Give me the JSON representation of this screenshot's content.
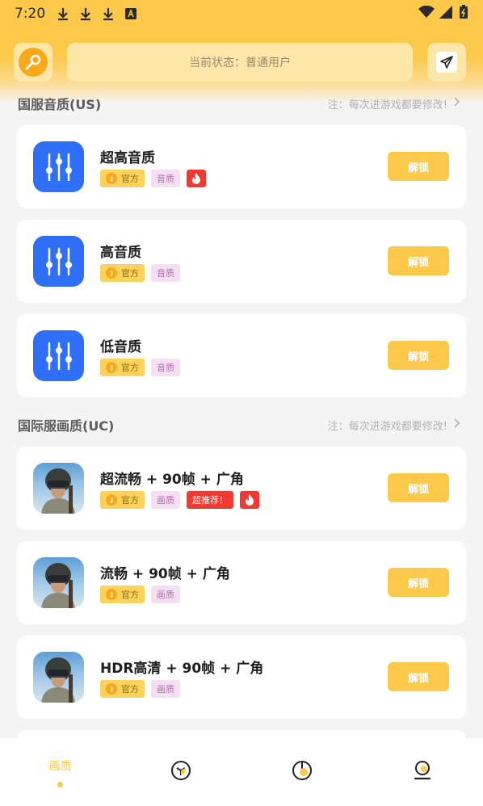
{
  "status_bar": {
    "time": "7:20"
  },
  "header": {
    "status_text": "当前状态：普通用户"
  },
  "sections": [
    {
      "title": "国服音质(US)",
      "note": "注：每次进游戏都要修改!"
    },
    {
      "title": "国际服画质(UC)",
      "note": "注：每次进游戏都要修改!"
    }
  ],
  "cards": [
    {
      "title": "超高音质",
      "tags": [
        "官方",
        "音质"
      ],
      "button": "解锁"
    },
    {
      "title": "高音质",
      "tags": [
        "官方",
        "音质"
      ],
      "button": "解锁"
    },
    {
      "title": "低音质",
      "tags": [
        "官方",
        "音质"
      ],
      "button": "解锁"
    },
    {
      "title": "超流畅 + 90帧 + 广角",
      "tags": [
        "官方",
        "画质",
        "超推荐！"
      ],
      "button": "解锁"
    },
    {
      "title": "流畅 + 90帧 + 广角",
      "tags": [
        "官方",
        "画质"
      ],
      "button": "解锁"
    },
    {
      "title": "HDR高清 + 90帧 + 广角",
      "tags": [
        "官方",
        "画质"
      ],
      "button": "解锁"
    }
  ],
  "bottom_nav": {
    "active_label": "画质"
  },
  "colors": {
    "accent": "#fcc94a",
    "eq_blue": "#2f6ef6",
    "hot_red": "#ef3a34"
  }
}
